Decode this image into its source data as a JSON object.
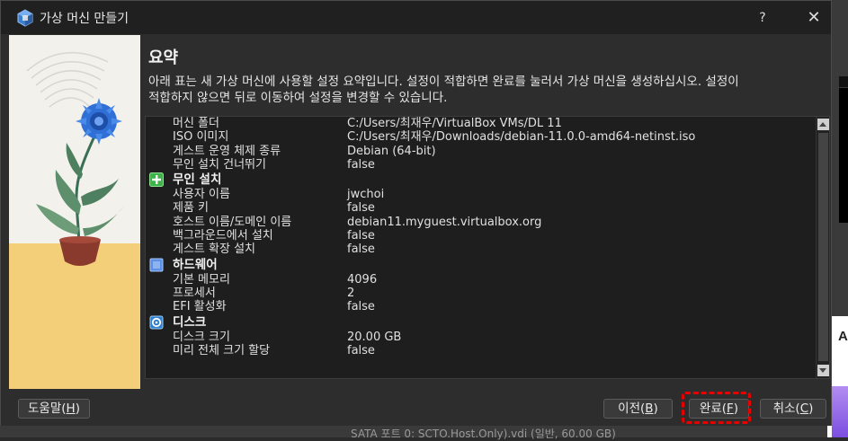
{
  "window": {
    "title": "가상 머신 만들기",
    "help_label": "?",
    "close_label": "✕"
  },
  "header": {
    "heading": "요약",
    "description": "아래 표는 새 가상 머신에 사용할 설정 요약입니다. 설정이 적합하면 완료를 눌러서 가상 머신을 생성하십시오. 설정이 적합하지 않으면 뒤로 이동하여 설정을 변경할 수 있습니다."
  },
  "summary": {
    "general": [
      {
        "key": "머신 폴더",
        "value": "C:/Users/최재우/VirtualBox VMs/DL 11"
      },
      {
        "key": "ISO 이미지",
        "value": "C:/Users/최재우/Downloads/debian-11.0.0-amd64-netinst.iso"
      },
      {
        "key": "게스트 운영 체제 종류",
        "value": "Debian (64-bit)"
      },
      {
        "key": "무인 설치 건너뛰기",
        "value": "false"
      }
    ],
    "unattended": {
      "title": "무인 설치",
      "icon": "add-install-icon",
      "rows": [
        {
          "key": "사용자 이름",
          "value": "jwchoi"
        },
        {
          "key": "제품 키",
          "value": "false"
        },
        {
          "key": "호스트 이름/도메인 이름",
          "value": "debian11.myguest.virtualbox.org"
        },
        {
          "key": "백그라운드에서 설치",
          "value": "false"
        },
        {
          "key": "게스트 확장 설치",
          "value": "false"
        }
      ]
    },
    "hardware": {
      "title": "하드웨어",
      "icon": "hardware-chip-icon",
      "rows": [
        {
          "key": "기본 메모리",
          "value": "4096"
        },
        {
          "key": "프로세서",
          "value": "2"
        },
        {
          "key": "EFI 활성화",
          "value": "false"
        }
      ]
    },
    "disk": {
      "title": "디스크",
      "icon": "disk-icon",
      "rows": [
        {
          "key": "디스크 크기",
          "value": "20.00 GB"
        },
        {
          "key": "미리 전체 크기 할당",
          "value": "false"
        }
      ]
    }
  },
  "footer": {
    "help": {
      "label": "도움말",
      "mnemonic": "H"
    },
    "back": {
      "label": "이전",
      "mnemonic": "B"
    },
    "finish": {
      "label": "완료",
      "mnemonic": "F"
    },
    "cancel": {
      "label": "취소",
      "mnemonic": "C"
    }
  },
  "background": {
    "card_letter": "A",
    "bottom_text": "SATA 포트 0:    SCTO.Host.Only).vdi (일반, 60.00 GB)"
  },
  "colors": {
    "accent_highlight": "#e60000",
    "dialog_bg": "#2d2d2d",
    "list_bg": "#1e1e1e",
    "section_green": "#3fb24a",
    "section_blue": "#5b8fe8"
  }
}
